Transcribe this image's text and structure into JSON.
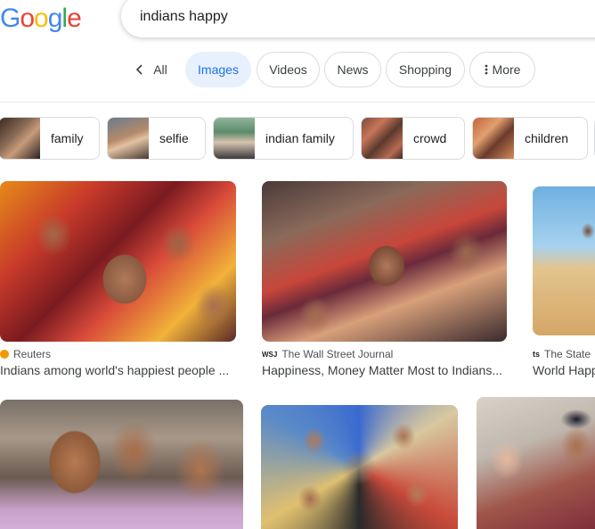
{
  "logo": {
    "text": "Google",
    "letters": [
      "G",
      "o",
      "o",
      "g",
      "l",
      "e"
    ],
    "colors": [
      "#4285F4",
      "#EA4335",
      "#FBBC05",
      "#4285F4",
      "#34A853",
      "#EA4335"
    ]
  },
  "search": {
    "query": "indians happy"
  },
  "tabs": [
    {
      "label": "All",
      "icon": "chevron-left-icon"
    },
    {
      "label": "Images",
      "active": true
    },
    {
      "label": "Videos"
    },
    {
      "label": "News"
    },
    {
      "label": "Shopping"
    },
    {
      "label": "More",
      "icon": "kebab-menu-icon"
    }
  ],
  "chips": [
    {
      "label": "family"
    },
    {
      "label": "selfie"
    },
    {
      "label": "indian family"
    },
    {
      "label": "crowd"
    },
    {
      "label": "children"
    }
  ],
  "results": [
    {
      "source": "Reuters",
      "title": "Indians among world's happiest people ...",
      "favicon_color": "#f29900"
    },
    {
      "source": "The Wall Street Journal",
      "source_prefix": "WSJ",
      "title": "Happiness, Money Matter Most to Indians..."
    },
    {
      "source": "The State",
      "source_prefix": "ts",
      "title": "World Happ"
    },
    {
      "source": "",
      "title": ""
    },
    {
      "source": "",
      "title": ""
    },
    {
      "source": "",
      "title": ""
    }
  ],
  "colors": {
    "accent": "#1a73e8",
    "active_tab_bg": "#e8f0fe",
    "border": "#dadce0"
  }
}
